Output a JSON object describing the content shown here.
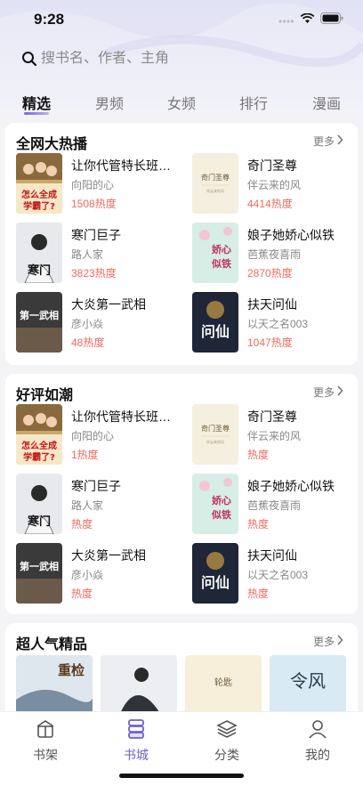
{
  "status": {
    "time": "9:28"
  },
  "search": {
    "placeholder": "搜书名、作者、主角"
  },
  "tabs": [
    {
      "label": "精选",
      "active": true
    },
    {
      "label": "男频"
    },
    {
      "label": "女频"
    },
    {
      "label": "排行"
    },
    {
      "label": "漫画"
    }
  ],
  "sections": [
    {
      "title": "全网大热播",
      "more": "更多",
      "books": [
        {
          "title": "让你代管特长班…",
          "author": "向阳的心",
          "heat": "1508热度",
          "cover_text": "怎么全成学霸了?"
        },
        {
          "title": "奇门圣尊",
          "author": "伴云来的风",
          "heat": "4414热度",
          "cover_text": "奇门圣尊"
        },
        {
          "title": "寒门巨子",
          "author": "路人家",
          "heat": "3823热度",
          "cover_text": "寒门巨子"
        },
        {
          "title": "娘子她娇心似铁",
          "author": "芭蕉夜喜雨",
          "heat": "2870热度",
          "cover_text": "娇心似铁"
        },
        {
          "title": "大炎第一武相",
          "author": "彦小焱",
          "heat": "48热度",
          "cover_text": "第一武相"
        },
        {
          "title": "扶天问仙",
          "author": "以天之名003",
          "heat": "1047热度",
          "cover_text": "问仙"
        }
      ]
    },
    {
      "title": "好评如潮",
      "more": "更多",
      "books": [
        {
          "title": "让你代管特长班…",
          "author": "向阳的心",
          "heat": "1热度",
          "cover_text": "怎么全成学霸了?"
        },
        {
          "title": "奇门圣尊",
          "author": "伴云来的风",
          "heat": "热度",
          "cover_text": "奇门圣尊"
        },
        {
          "title": "寒门巨子",
          "author": "路人家",
          "heat": "热度",
          "cover_text": "寒门巨子"
        },
        {
          "title": "娘子她娇心似铁",
          "author": "芭蕉夜喜雨",
          "heat": "热度",
          "cover_text": "娇心似铁"
        },
        {
          "title": "大炎第一武相",
          "author": "彦小焱",
          "heat": "热度",
          "cover_text": "第一武相"
        },
        {
          "title": "扶天问仙",
          "author": "以天之名003",
          "heat": "热度",
          "cover_text": "问仙"
        }
      ]
    },
    {
      "title": "超人气精品",
      "more": "更多",
      "covers": [
        {
          "cover_text": "重检之"
        },
        {
          "cover_text": ""
        },
        {
          "cover_text": "轮匙"
        },
        {
          "cover_text": "令风"
        }
      ]
    }
  ],
  "nav": [
    {
      "label": "书架",
      "icon": "bookshelf-icon"
    },
    {
      "label": "书城",
      "icon": "bookstore-icon",
      "active": true
    },
    {
      "label": "分类",
      "icon": "category-icon"
    },
    {
      "label": "我的",
      "icon": "profile-icon"
    }
  ],
  "colors": {
    "accent": "#6f61c9",
    "heat": "#ee6a5d"
  }
}
